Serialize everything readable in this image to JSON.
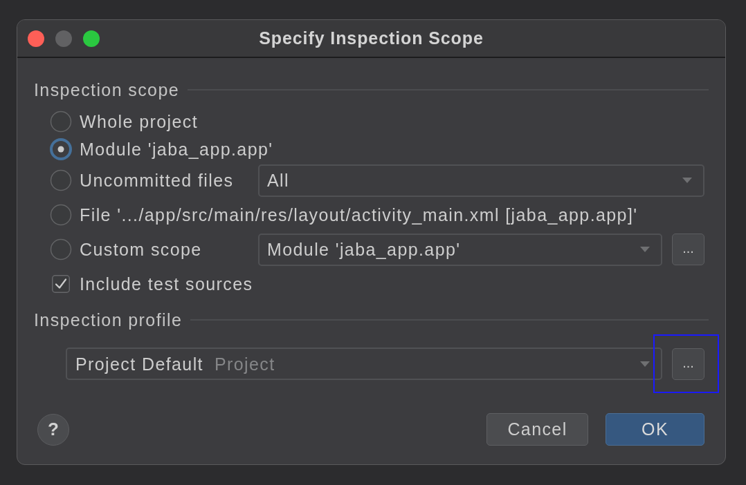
{
  "window": {
    "title": "Specify Inspection Scope",
    "controls": [
      {
        "kind": "close",
        "disabled": false
      },
      {
        "kind": "minimize",
        "disabled": true
      },
      {
        "kind": "zoom",
        "disabled": false
      }
    ]
  },
  "scope": {
    "title": "Inspection scope",
    "options": [
      {
        "label": "Whole project",
        "selected": false
      },
      {
        "label": "Module 'jaba_app.app'",
        "selected": true
      },
      {
        "label": "Uncommitted files",
        "selected": false,
        "dropdown": {
          "value": "All"
        }
      },
      {
        "label": "File '.../app/src/main/res/layout/activity_main.xml [jaba_app.app]'",
        "selected": false
      },
      {
        "label": "Custom scope",
        "selected": false,
        "dropdown": {
          "value": "Module 'jaba_app.app'"
        },
        "browse_button": "..."
      }
    ],
    "include_test_sources": {
      "label": "Include test sources",
      "checked": true
    }
  },
  "profile": {
    "title": "Inspection profile",
    "dropdown": {
      "value": "Project Default",
      "hint": "Project"
    },
    "browse_button": {
      "label": "...",
      "highlighted": true
    }
  },
  "footer": {
    "help_button": "?",
    "buttons": [
      {
        "label": "Cancel",
        "default": false
      },
      {
        "label": "OK",
        "default": true
      }
    ]
  }
}
